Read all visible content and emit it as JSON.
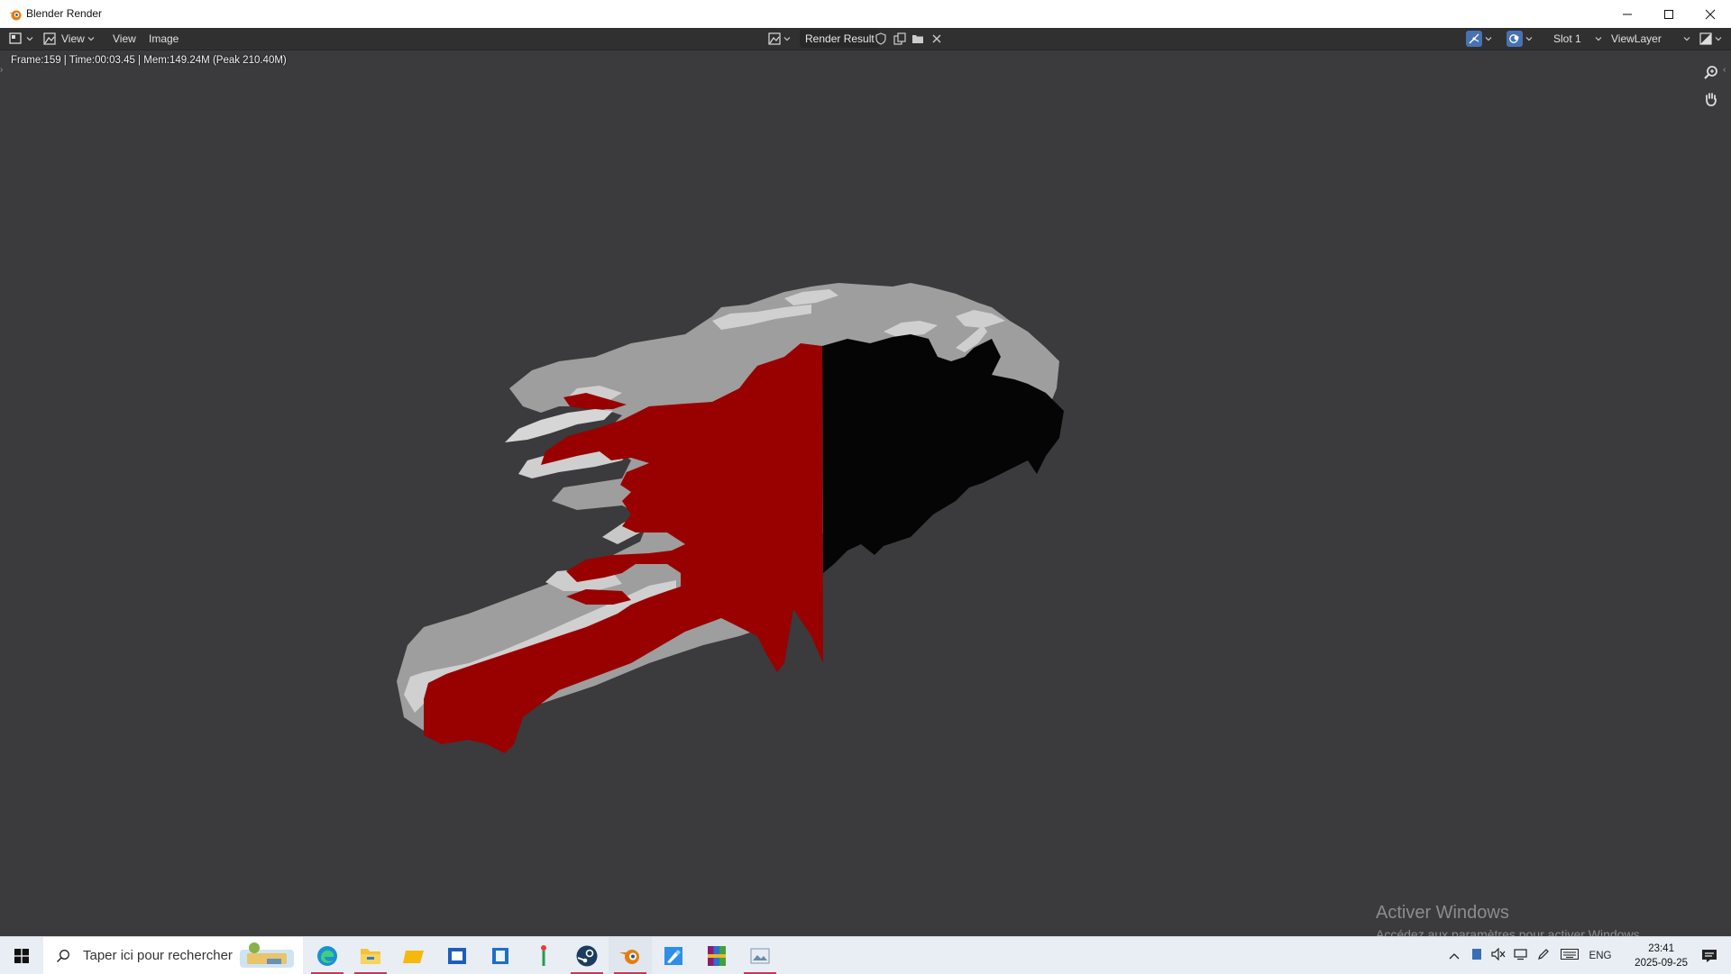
{
  "window": {
    "title": "Blender Render"
  },
  "header": {
    "menus": [
      "View",
      "View",
      "Image"
    ],
    "image_name": "Render Result",
    "slot": "Slot 1",
    "view_layer": "ViewLayer"
  },
  "stats": "Frame:159 | Time:00:03.45 | Mem:149.24M (Peak 210.40M)",
  "render": {
    "colors": {
      "background": "#3b3a3d",
      "red": "#990000",
      "black": "#050505",
      "extrusion": "#b9b9b9"
    }
  },
  "watermark": {
    "title": "Activer Windows",
    "subtitle": "Accédez aux paramètres pour activer Windows."
  },
  "taskbar": {
    "search_placeholder": "Taper ici pour rechercher",
    "apps": [
      "edge-icon",
      "file-explorer-icon",
      "folder-icon",
      "app-blue-icon",
      "app-blue2-icon",
      "app-figure-icon",
      "steam-icon",
      "blender-icon",
      "app-paint-icon",
      "winrar-icon",
      "app-image-icon"
    ],
    "lang": "ENG",
    "time": "23:41",
    "date": "2025-09-25"
  }
}
